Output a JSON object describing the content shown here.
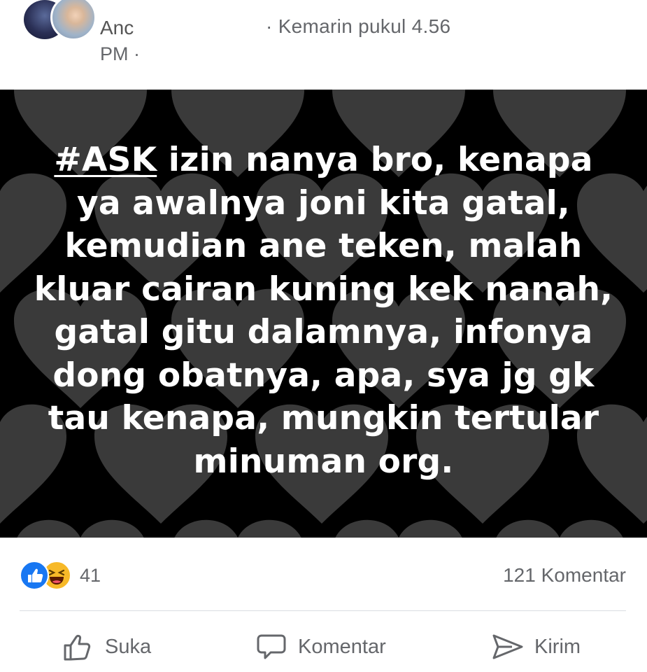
{
  "header": {
    "author": "Anc",
    "time_line1": "· Kemarin pukul 4.56",
    "time_line2": "PM ·"
  },
  "post": {
    "hashtag": "#ASK",
    "text_rest": " izin nanya bro, kenapa ya awalnya joni kita gatal, kemudian ane teken, malah kluar cairan kuning kek nanah, gatal gitu dalamnya, infonya dong obatnya, apa, sya jg gk tau kenapa, mungkin tertular minuman org."
  },
  "reactions": {
    "count": "41",
    "icons": [
      "like-icon",
      "haha-icon"
    ]
  },
  "comments": {
    "count_label": "121 Komentar"
  },
  "actions": {
    "like": "Suka",
    "comment": "Komentar",
    "send": "Kirim"
  },
  "colors": {
    "banner_bg": "#000000",
    "heart_fill": "#3a3a3a",
    "like_blue": "#1877f2",
    "haha_yellow": "#f7b928",
    "muted_text": "#65676b"
  }
}
